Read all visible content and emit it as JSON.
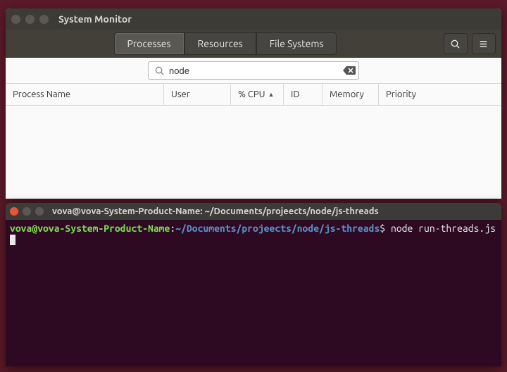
{
  "system_monitor": {
    "title": "System Monitor",
    "tabs": {
      "processes": "Processes",
      "resources": "Resources",
      "filesystems": "File Systems"
    },
    "active_tab": "processes",
    "search": {
      "value": "node",
      "placeholder": ""
    },
    "columns": {
      "process_name": "Process Name",
      "user": "User",
      "cpu": "% CPU",
      "id": "ID",
      "memory": "Memory",
      "priority": "Priority"
    },
    "sorted_column": "cpu",
    "sort_direction": "asc",
    "rows": []
  },
  "terminal": {
    "title": "vova@vova-System-Product-Name: ~/Documents/projeects/node/js-threads",
    "prompt": {
      "userhost": "vova@vova-System-Product-Name",
      "sep1": ":",
      "path": "~/Documents/projeects/node/js-threads",
      "sep2": "$"
    },
    "command": "node run-threads.js "
  }
}
